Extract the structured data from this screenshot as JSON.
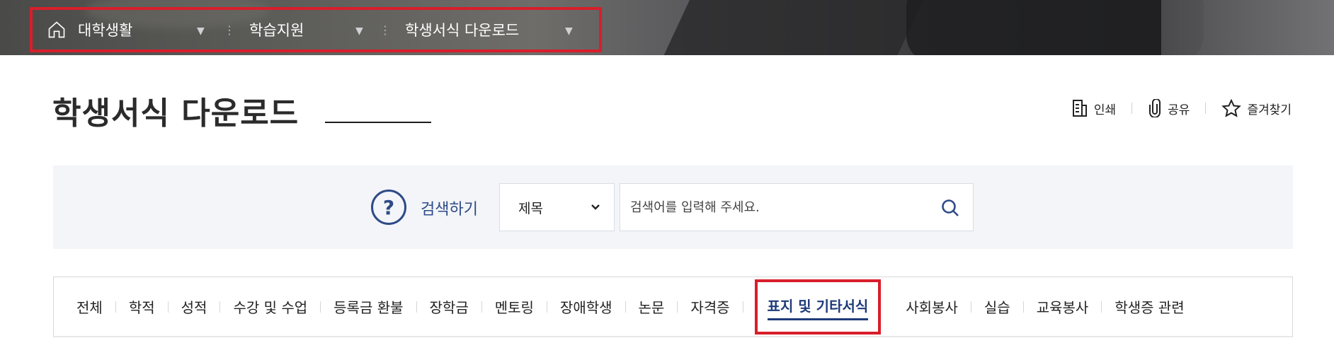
{
  "breadcrumb": {
    "items": [
      {
        "label": "대학생활"
      },
      {
        "label": "학습지원"
      },
      {
        "label": "학생서식 다운로드"
      }
    ]
  },
  "page": {
    "title": "학생서식 다운로드"
  },
  "utils": {
    "print": "인쇄",
    "share": "공유",
    "favorite": "즐겨찾기"
  },
  "search": {
    "label": "검색하기",
    "help_symbol": "?",
    "field_select": "제목",
    "placeholder": "검색어를 입력해 주세요."
  },
  "tabs": [
    {
      "label": "전체"
    },
    {
      "label": "학적"
    },
    {
      "label": "성적"
    },
    {
      "label": "수강 및 수업"
    },
    {
      "label": "등록금 환불"
    },
    {
      "label": "장학금"
    },
    {
      "label": "멘토링"
    },
    {
      "label": "장애학생"
    },
    {
      "label": "논문"
    },
    {
      "label": "자격증"
    },
    {
      "label": "표지 및 기타서식"
    },
    {
      "label": "사회봉사"
    },
    {
      "label": "실습"
    },
    {
      "label": "교육봉사"
    },
    {
      "label": "학생증 관련"
    }
  ],
  "active_tab_index": 10,
  "colors": {
    "accent": "#2e4a87",
    "highlight_border": "#d81e2b",
    "panel_bg": "#f3f5f8"
  },
  "icons": {
    "home": "home-icon",
    "print": "document-icon",
    "share": "paperclip-icon",
    "favorite": "star-icon",
    "search": "search-icon",
    "dropdown": "chevron-down-icon"
  }
}
